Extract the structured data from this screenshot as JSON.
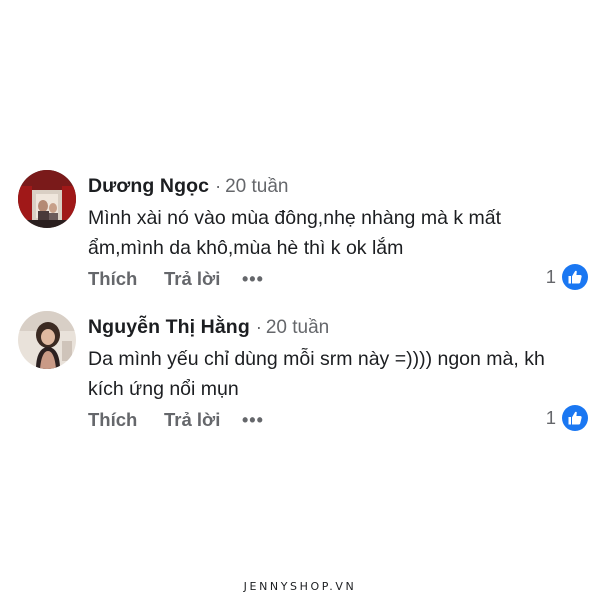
{
  "comments": [
    {
      "author": "Dương Ngọc",
      "separator": "·",
      "time": "20 tuần",
      "text": "Mình xài nó vào mùa đông,nhẹ nhàng mà k mất ẩm,mình da khô,mùa hè thì k ok lắm",
      "actions": {
        "like_label": "Thích",
        "reply_label": "Trả lời",
        "more_label": "•••"
      },
      "reaction_count": "1",
      "reaction_icon": "like-icon",
      "avatar": "user-avatar"
    },
    {
      "author": "Nguyễn Thị Hằng",
      "separator": "·",
      "time": "20 tuần",
      "text": "Da mình yếu chỉ dùng mỗi srm này =)))) ngon mà, kh kích ứng nổi mụn",
      "actions": {
        "like_label": "Thích",
        "reply_label": "Trả lời",
        "more_label": "•••"
      },
      "reaction_count": "1",
      "reaction_icon": "like-icon",
      "avatar": "user-avatar"
    }
  ],
  "footer": {
    "watermark": "JENNYSHOP.VN"
  },
  "colors": {
    "text_primary": "#1c1e21",
    "text_secondary": "#65676b",
    "like_blue": "#1a77f2",
    "background": "#ffffff"
  }
}
